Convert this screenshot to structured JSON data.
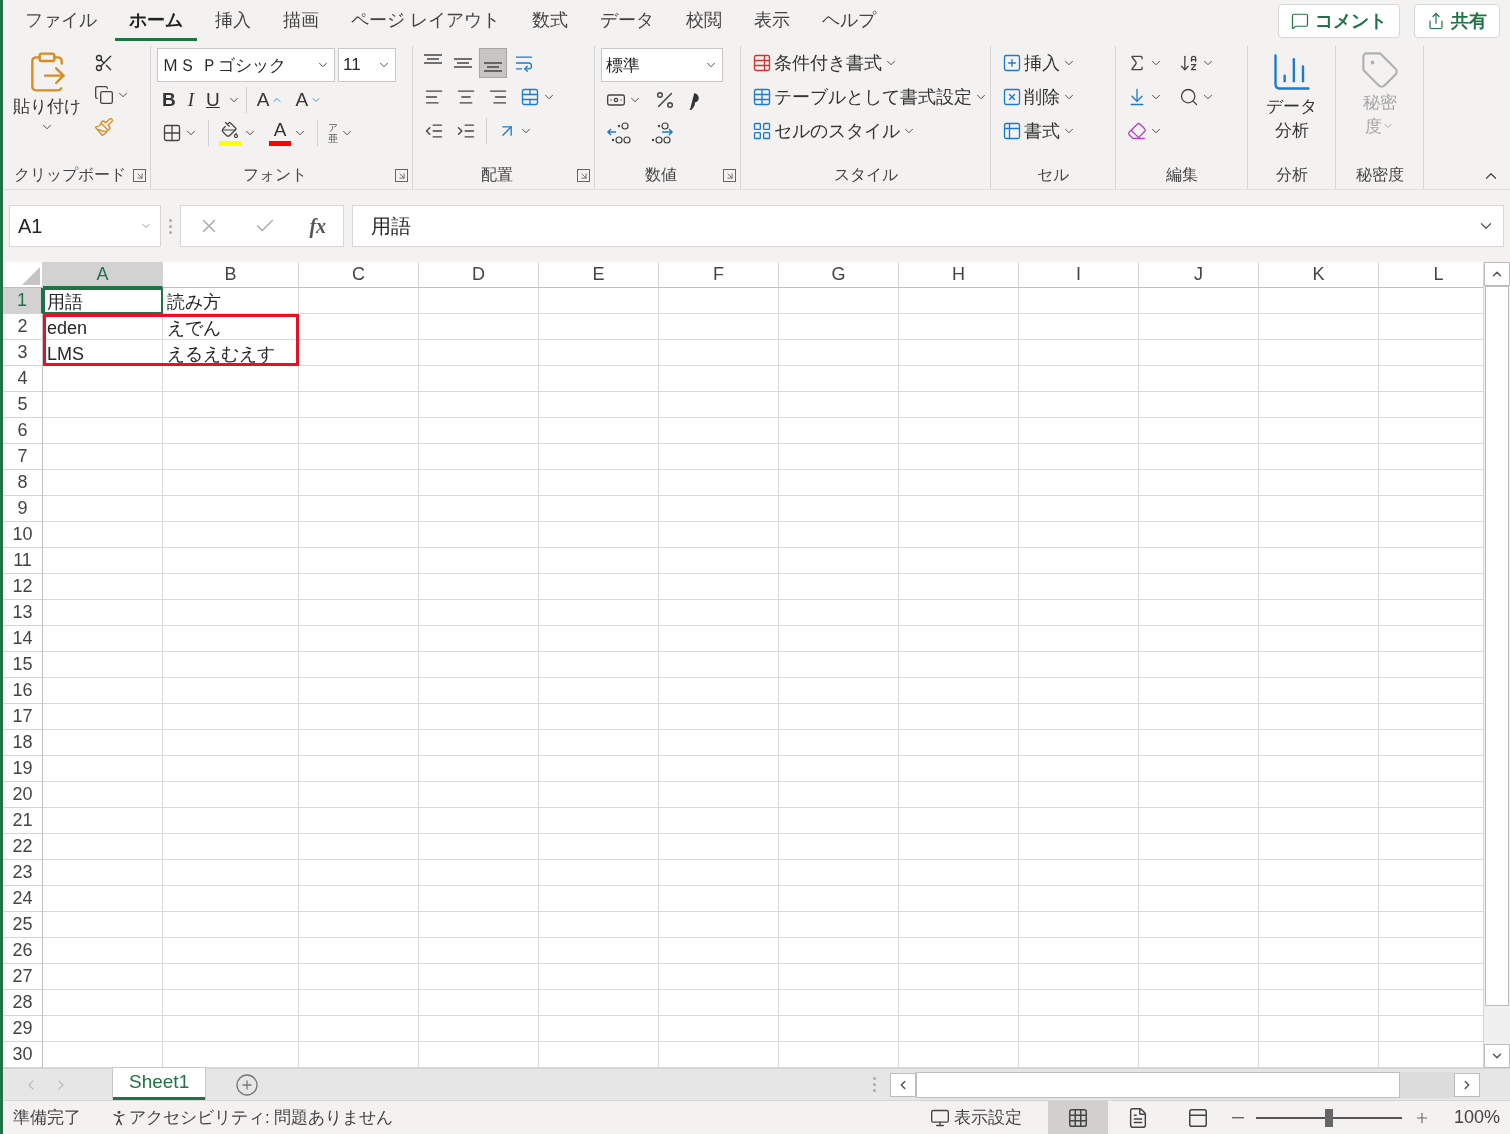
{
  "menu_tabs": [
    {
      "label": "ファイル",
      "selected": false
    },
    {
      "label": "ホーム",
      "selected": true
    },
    {
      "label": "挿入",
      "selected": false
    },
    {
      "label": "描画",
      "selected": false
    },
    {
      "label": "ページ レイアウト",
      "selected": false
    },
    {
      "label": "数式",
      "selected": false
    },
    {
      "label": "データ",
      "selected": false
    },
    {
      "label": "校閲",
      "selected": false
    },
    {
      "label": "表示",
      "selected": false
    },
    {
      "label": "ヘルプ",
      "selected": false
    }
  ],
  "header_buttons": [
    {
      "kind": "comment",
      "label": "コメント"
    },
    {
      "kind": "share",
      "label": "共有"
    }
  ],
  "ribbon": {
    "clipboard": {
      "paste_label": "貼り付け",
      "group_label": "クリップボード"
    },
    "font": {
      "font_name": "ＭＳ Ｐゴシック",
      "font_size": "11",
      "style_letters": [
        "B",
        "I",
        "U"
      ],
      "grow_letter": "A",
      "shrink_letter": "A",
      "font_color_letter": "A",
      "phonetic": [
        "ア",
        "亜"
      ],
      "group_label": "フォント"
    },
    "alignment": {
      "vertical": [
        {
          "kind": "top",
          "selected": false
        },
        {
          "kind": "middle",
          "selected": false
        },
        {
          "kind": "bottom",
          "selected": true
        }
      ],
      "group_label": "配置"
    },
    "number": {
      "format": "標準",
      "group_label": "数値"
    },
    "styles": {
      "items": [
        {
          "kind": "conditional",
          "label": "条件付き書式"
        },
        {
          "kind": "table",
          "label": "テーブルとして書式設定"
        },
        {
          "kind": "cell",
          "label": "セルのスタイル"
        }
      ],
      "group_label": "スタイル"
    },
    "cells": {
      "items": [
        {
          "kind": "insert",
          "label": "挿入"
        },
        {
          "kind": "delete",
          "label": "削除"
        },
        {
          "kind": "format",
          "label": "書式"
        }
      ],
      "group_label": "セル"
    },
    "editing": {
      "group_label": "編集"
    },
    "analysis": {
      "lines": [
        "データ",
        "分析"
      ],
      "group_label": "分析"
    },
    "sensitivity": {
      "lines": [
        "秘密",
        "度"
      ],
      "disabled": true,
      "group_label": "秘密度"
    }
  },
  "formula_bar": {
    "name_box": "A1",
    "function_glyph": "fx",
    "formula": "用語"
  },
  "columns": [
    {
      "label": "A",
      "selected": true
    },
    {
      "label": "B",
      "selected": false
    },
    {
      "label": "C",
      "selected": false
    },
    {
      "label": "D",
      "selected": false
    },
    {
      "label": "E",
      "selected": false
    },
    {
      "label": "F",
      "selected": false
    },
    {
      "label": "G",
      "selected": false
    },
    {
      "label": "H",
      "selected": false
    },
    {
      "label": "I",
      "selected": false
    },
    {
      "label": "J",
      "selected": false
    },
    {
      "label": "K",
      "selected": false
    },
    {
      "label": "L",
      "selected": false
    }
  ],
  "rows": [
    {
      "label": "1",
      "selected": true,
      "outlined": false,
      "cells": [
        {
          "text": "用語",
          "selected": true
        },
        {
          "text": "読み方",
          "selected": false
        }
      ]
    },
    {
      "label": "2",
      "selected": false,
      "outlined": true,
      "cells": [
        {
          "text": "eden",
          "selected": false
        },
        {
          "text": "えでん",
          "selected": false
        }
      ]
    },
    {
      "label": "3",
      "selected": false,
      "outlined": true,
      "cells": [
        {
          "text": "LMS",
          "selected": false
        },
        {
          "text": "えるえむえす",
          "selected": false
        }
      ]
    },
    {
      "label": "4",
      "selected": false,
      "outlined": false
    },
    {
      "label": "5",
      "selected": false,
      "outlined": false
    },
    {
      "label": "6",
      "selected": false,
      "outlined": false
    },
    {
      "label": "7",
      "selected": false,
      "outlined": false
    },
    {
      "label": "8",
      "selected": false,
      "outlined": false
    },
    {
      "label": "9",
      "selected": false,
      "outlined": false
    },
    {
      "label": "10",
      "selected": false,
      "outlined": false
    },
    {
      "label": "11",
      "selected": false,
      "outlined": false
    },
    {
      "label": "12",
      "selected": false,
      "outlined": false
    },
    {
      "label": "13",
      "selected": false,
      "outlined": false
    },
    {
      "label": "14",
      "selected": false,
      "outlined": false
    },
    {
      "label": "15",
      "selected": false,
      "outlined": false
    },
    {
      "label": "16",
      "selected": false,
      "outlined": false
    },
    {
      "label": "17",
      "selected": false,
      "outlined": false
    },
    {
      "label": "18",
      "selected": false,
      "outlined": false
    },
    {
      "label": "19",
      "selected": false,
      "outlined": false
    },
    {
      "label": "20",
      "selected": false,
      "outlined": false
    },
    {
      "label": "21",
      "selected": false,
      "outlined": false
    },
    {
      "label": "22",
      "selected": false,
      "outlined": false
    },
    {
      "label": "23",
      "selected": false,
      "outlined": false
    },
    {
      "label": "24",
      "selected": false,
      "outlined": false
    },
    {
      "label": "25",
      "selected": false,
      "outlined": false
    },
    {
      "label": "26",
      "selected": false,
      "outlined": false
    },
    {
      "label": "27",
      "selected": false,
      "outlined": false
    },
    {
      "label": "28",
      "selected": false,
      "outlined": false
    },
    {
      "label": "29",
      "selected": false,
      "outlined": false
    },
    {
      "label": "30",
      "selected": false,
      "outlined": false
    }
  ],
  "sheet_tabs": [
    {
      "label": "Sheet1",
      "selected": true
    }
  ],
  "status_bar": {
    "ready": "準備完了",
    "accessibility": "アクセシビリティ: 問題ありません",
    "display_settings": "表示設定",
    "views": [
      {
        "kind": "normal",
        "selected": true
      },
      {
        "kind": "page_layout",
        "selected": false
      },
      {
        "kind": "page_break",
        "selected": false
      }
    ],
    "zoom": {
      "level": 0.5,
      "reading": "100%"
    }
  }
}
